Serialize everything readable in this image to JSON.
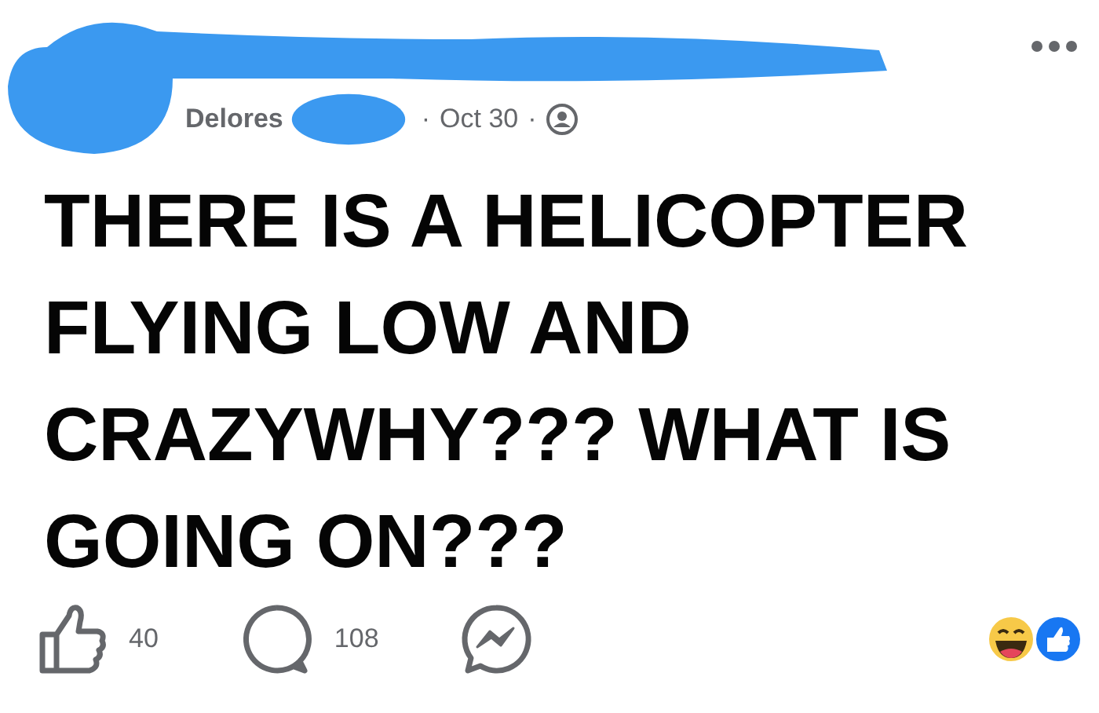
{
  "post": {
    "author": "Delores",
    "separator_1": "·",
    "date": "Oct 30",
    "separator_2": "·",
    "text": "THERE IS A HELICOPTER FLYING LOW AND CRAZYWHY??? WHAT IS GOING ON???"
  },
  "actions": [
    {
      "kind": "like",
      "count": "40"
    },
    {
      "kind": "comment",
      "count": "108"
    },
    {
      "kind": "share"
    }
  ]
}
